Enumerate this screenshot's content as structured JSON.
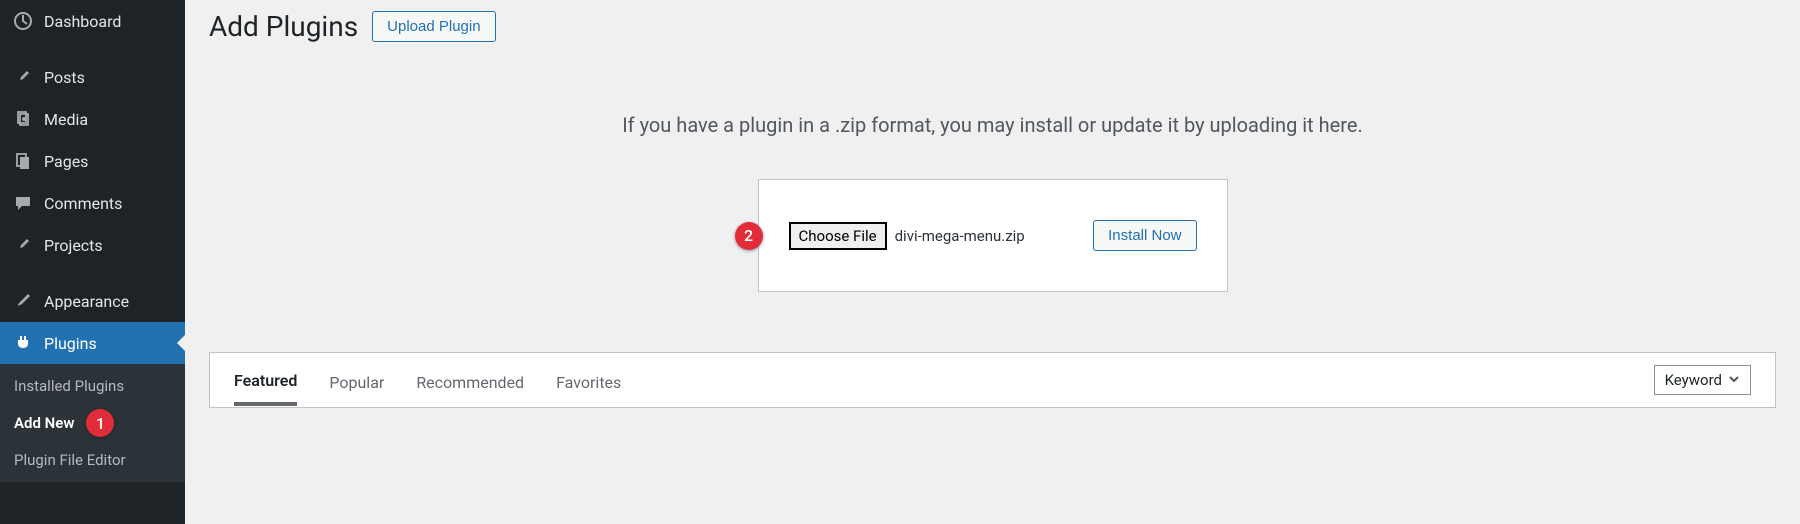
{
  "sidebar": {
    "items": [
      {
        "label": "Dashboard",
        "icon": "dashboard"
      },
      {
        "label": "Posts",
        "icon": "pin"
      },
      {
        "label": "Media",
        "icon": "media"
      },
      {
        "label": "Pages",
        "icon": "page"
      },
      {
        "label": "Comments",
        "icon": "comment"
      },
      {
        "label": "Projects",
        "icon": "pin"
      },
      {
        "label": "Appearance",
        "icon": "brush"
      },
      {
        "label": "Plugins",
        "icon": "plug",
        "active": true
      }
    ],
    "submenu": [
      {
        "label": "Installed Plugins"
      },
      {
        "label": "Add New",
        "active": true,
        "badge": "1"
      },
      {
        "label": "Plugin File Editor"
      }
    ]
  },
  "header": {
    "title": "Add Plugins",
    "upload_button": "Upload Plugin"
  },
  "upload": {
    "instruction": "If you have a plugin in a .zip format, you may install or update it by uploading it here.",
    "choose_file_label": "Choose File",
    "file_name": "divi-mega-menu.zip",
    "install_button": "Install Now",
    "badge": "2"
  },
  "filter": {
    "tabs": [
      {
        "label": "Featured",
        "active": true
      },
      {
        "label": "Popular"
      },
      {
        "label": "Recommended"
      },
      {
        "label": "Favorites"
      }
    ],
    "search_type": "Keyword"
  }
}
